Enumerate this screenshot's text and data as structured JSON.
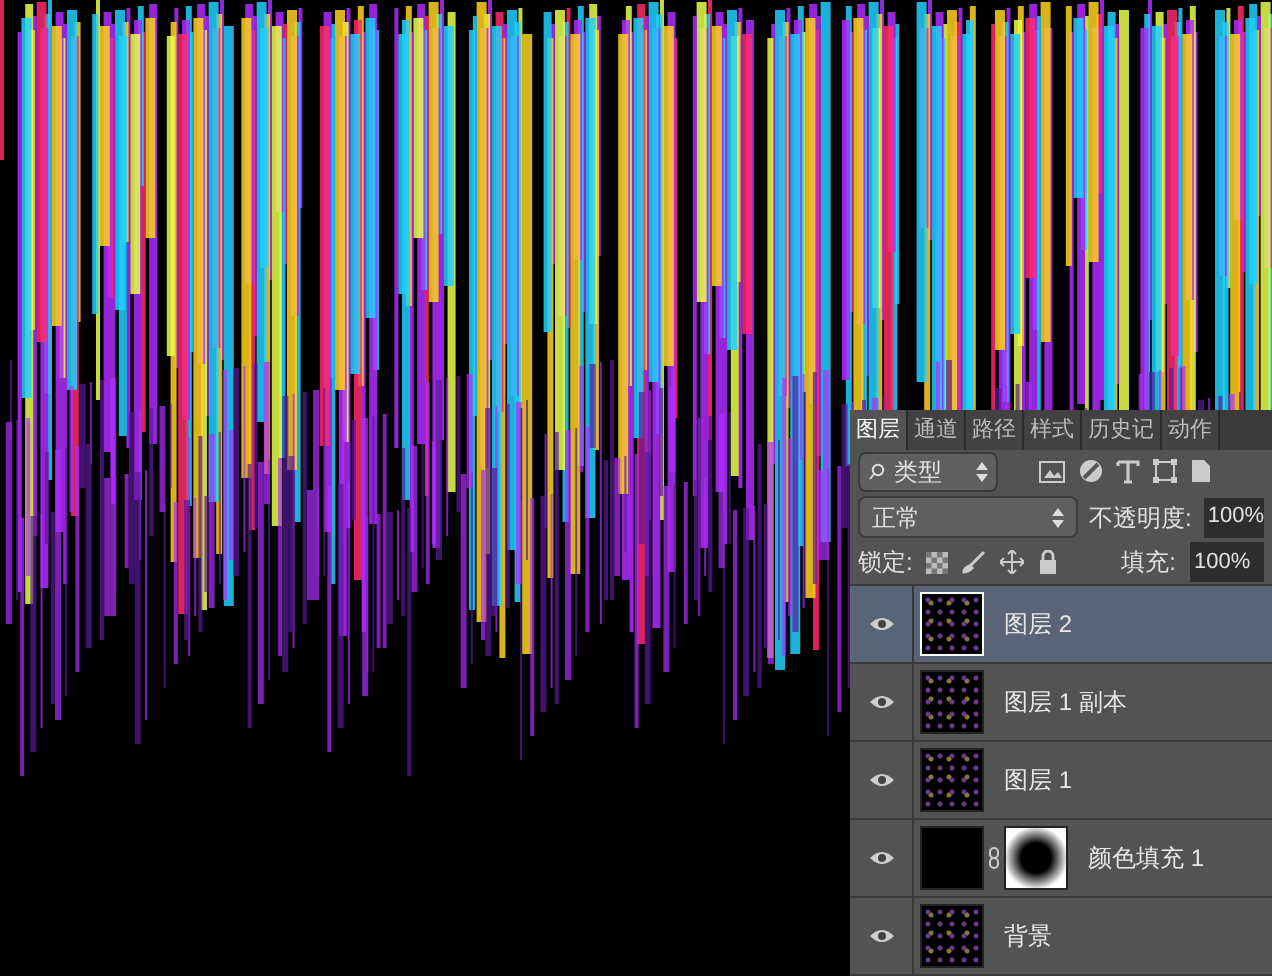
{
  "panel": {
    "tabs": [
      {
        "label": "图层",
        "selected": true
      },
      {
        "label": "通道",
        "selected": false
      },
      {
        "label": "路径",
        "selected": false
      },
      {
        "label": "样式",
        "selected": false
      },
      {
        "label": "历史记",
        "selected": false
      },
      {
        "label": "动作",
        "selected": false
      }
    ],
    "filter": {
      "value": "类型"
    },
    "blend_mode": {
      "value": "正常"
    },
    "opacity": {
      "label": "不透明度:",
      "value": "100%"
    },
    "lock": {
      "label": "锁定:"
    },
    "fill": {
      "label": "填充:",
      "value": "100%"
    },
    "layers": [
      {
        "name": "图层 2",
        "kind": "pixel",
        "visible": true,
        "selected": true
      },
      {
        "name": "图层 1 副本",
        "kind": "pixel",
        "visible": true,
        "selected": false
      },
      {
        "name": "图层 1",
        "kind": "pixel",
        "visible": true,
        "selected": false
      },
      {
        "name": "颜色填充 1",
        "kind": "fill",
        "visible": true,
        "selected": false
      },
      {
        "name": "背景",
        "kind": "pixel",
        "visible": true,
        "selected": false
      }
    ]
  }
}
